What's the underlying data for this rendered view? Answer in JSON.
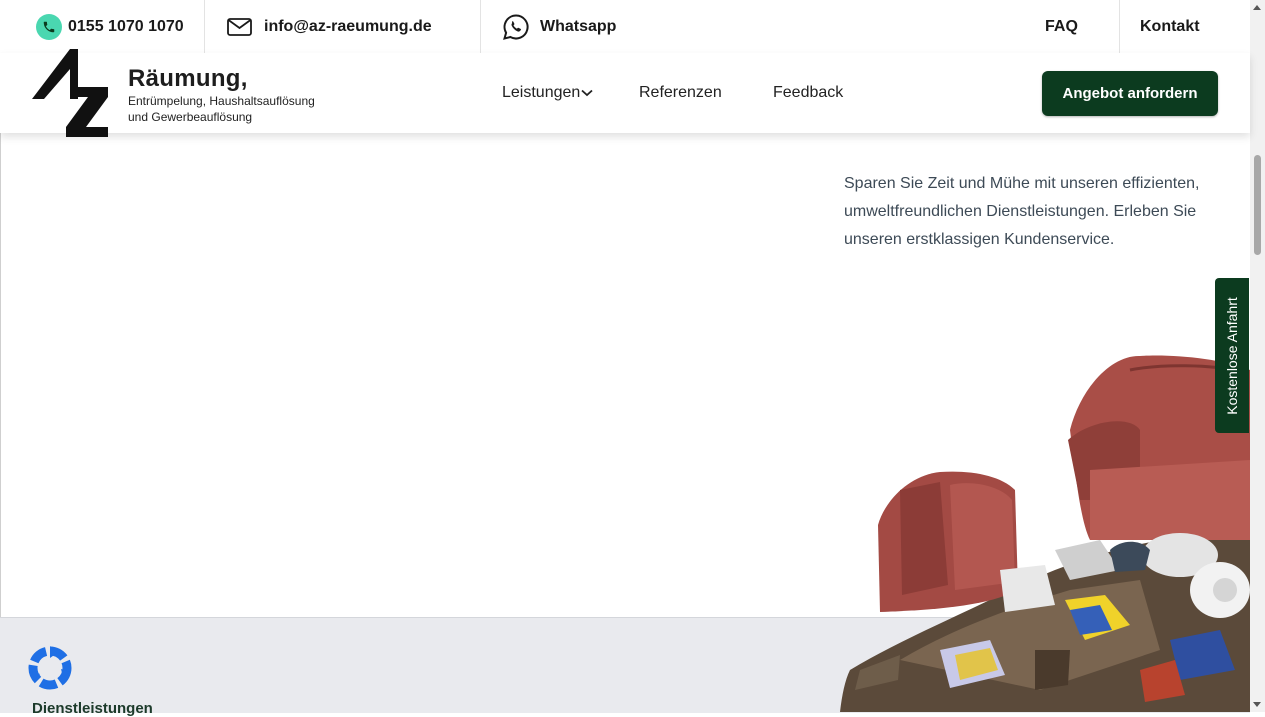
{
  "topbar": {
    "phone": "0155 1070 1070",
    "email": "info@az-raeumung.de",
    "whatsapp": "Whatsapp",
    "faq": "FAQ",
    "kontakt": "Kontakt"
  },
  "header": {
    "brand_title": "Räumung,",
    "brand_sub_line1": "Entrümpelung, Haushaltsauflösung",
    "brand_sub_line2": "und Gewerbeauflösung",
    "nav": {
      "leistungen": "Leistungen",
      "referenzen": "Referenzen",
      "feedback": "Feedback"
    },
    "cta": "Angebot anfordern"
  },
  "hero": {
    "text": "Sparen Sie Zeit und Mühe mit unseren effizienten, umweltfreundlichen Dienstleistungen. Erleben Sie unseren erstklassigen Kundenservice."
  },
  "side_tab": "Kostenlose Anfahrt",
  "services": {
    "label": "Dienstleistungen"
  },
  "colors": {
    "brand_green": "#0c3b1f",
    "phone_icon_bg": "#4ad7b0",
    "recycle_blue": "#1f6fe5",
    "band_gray": "#e9eaee"
  }
}
